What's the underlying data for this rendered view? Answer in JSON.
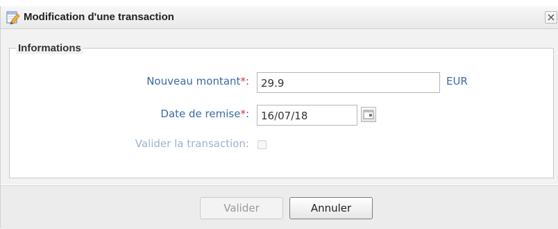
{
  "dialog": {
    "title": "Modification d'une transaction",
    "close_symbol": "×",
    "icon": "edit-pencil-icon"
  },
  "fieldset": {
    "legend": "Informations"
  },
  "fields": {
    "amount": {
      "label": "Nouveau montant",
      "required_mark": "*",
      "colon": ":",
      "value": "29.9",
      "unit": "EUR"
    },
    "date": {
      "label": "Date de remise",
      "required_mark": "*",
      "colon": ":",
      "value": "16/07/18",
      "icon": "calendar-icon"
    },
    "validate": {
      "label": "Valider la transaction:",
      "checked": false,
      "disabled": true
    }
  },
  "buttons": {
    "validate_label": "Valider",
    "cancel_label": "Annuler"
  },
  "colors": {
    "label": "#3b6aa0",
    "required": "#e03030",
    "disabled_label": "#9fb3c8"
  }
}
